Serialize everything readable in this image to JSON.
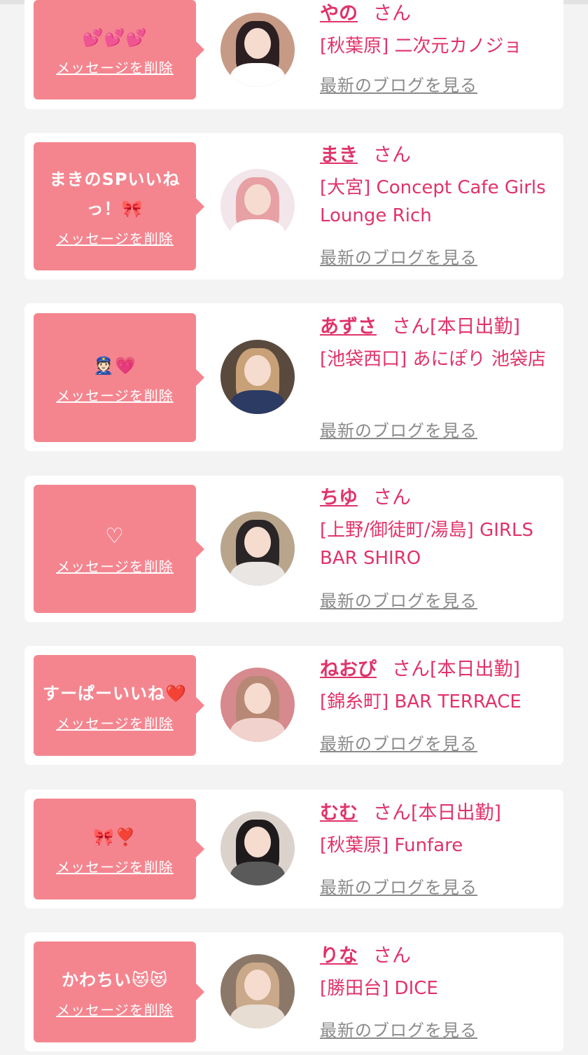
{
  "cards": [
    {
      "message": "💕💕💕",
      "delete_label": "メッセージを削除",
      "name": "やの",
      "suffix": "さん",
      "status": "",
      "shop": "[秋葉原] 二次元カノジョ",
      "blog_label": "最新のブログを見る",
      "avatar": {
        "hair": "#2b1f22",
        "bg": "#c79a86",
        "body": "#ffffff"
      }
    },
    {
      "message": "まきのSPいいね\nっ！🎀",
      "delete_label": "メッセージを削除",
      "name": "まき",
      "suffix": "さん",
      "status": "",
      "shop": "[大宮] Concept Cafe Girls Lounge Rich",
      "blog_label": "最新のブログを見る",
      "avatar": {
        "hair": "#e7a0a4",
        "bg": "#f2e6ea",
        "body": "#ffffff"
      }
    },
    {
      "message": "👮🏻💗",
      "delete_label": "メッセージを削除",
      "name": "あずさ",
      "suffix": "さん[本日出勤]",
      "status": "",
      "shop": "[池袋西口] あにぽり 池袋店",
      "blog_label": "最新のブログを見る",
      "avatar": {
        "hair": "#c9a178",
        "bg": "#5a4a3e",
        "body": "#2b3b63"
      }
    },
    {
      "message": "♡",
      "delete_label": "メッセージを削除",
      "name": "ちゆ",
      "suffix": "さん",
      "status": "",
      "shop": "[上野/御徒町/湯島] GIRLS BAR SHIRO",
      "blog_label": "最新のブログを見る",
      "avatar": {
        "hair": "#2a2526",
        "bg": "#b8a58c",
        "body": "#e9e6e4"
      }
    },
    {
      "message": "すーぱーいいね❤️",
      "delete_label": "メッセージを削除",
      "name": "ねおぴ",
      "suffix": "さん[本日出勤]",
      "status": "",
      "shop": "[錦糸町] BAR TERRACE",
      "blog_label": "最新のブログを見る",
      "avatar": {
        "hair": "#b88876",
        "bg": "#d68a8e",
        "body": "#f1d2cc"
      }
    },
    {
      "message": "🎀❣️",
      "delete_label": "メッセージを削除",
      "name": "むむ",
      "suffix": "さん[本日出勤]",
      "status": "",
      "shop": "[秋葉原] Funfare",
      "blog_label": "最新のブログを見る",
      "avatar": {
        "hair": "#1f1b1c",
        "bg": "#dcd2cc",
        "body": "#5a5a5a"
      }
    },
    {
      "message": "かわちい😻😻",
      "delete_label": "メッセージを削除",
      "name": "りな",
      "suffix": "さん",
      "status": "",
      "shop": "[勝田台] DICE",
      "blog_label": "最新のブログを見る",
      "avatar": {
        "hair": "#c9a98a",
        "bg": "#8c7868",
        "body": "#e8ddd3"
      }
    }
  ]
}
